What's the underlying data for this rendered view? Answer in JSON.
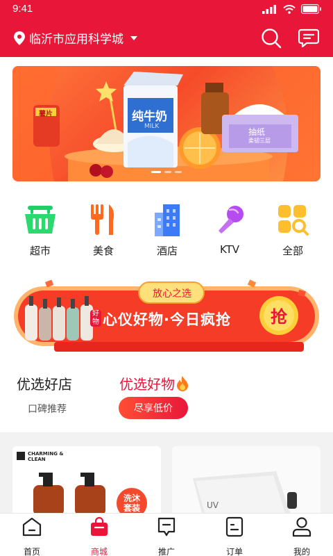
{
  "status": {
    "time": "9:41"
  },
  "header": {
    "location": "临沂市应用科学城"
  },
  "banner": {
    "milk_text": "纯牛奶",
    "milk_sub": "MILK",
    "badge_text": "薯片",
    "tissue_text": "抽纸",
    "tissue_sub": "柔韧三层"
  },
  "categories": [
    {
      "label": "超市",
      "icon": "basket-icon"
    },
    {
      "label": "美食",
      "icon": "cutlery-icon"
    },
    {
      "label": "酒店",
      "icon": "building-icon"
    },
    {
      "label": "KTV",
      "icon": "microphone-icon"
    },
    {
      "label": "全部",
      "icon": "grid-search-icon"
    }
  ],
  "promo": {
    "tag": "放心之选",
    "title": "心仪好物·今日疯抢",
    "side_label": "好物",
    "grab": "抢"
  },
  "selections": {
    "left_title": "优选好店",
    "left_sub": "口碑推荐",
    "right_title": "优选好物",
    "right_button": "尽享低价"
  },
  "products": [
    {
      "brand": "CHARMING & CLEAN",
      "tag": "洗沐套装"
    },
    {
      "mark": "UV"
    }
  ],
  "tabbar": [
    {
      "label": "首页",
      "active": false
    },
    {
      "label": "商城",
      "active": true
    },
    {
      "label": "推广",
      "active": false
    },
    {
      "label": "订单",
      "active": false
    },
    {
      "label": "我的",
      "active": false
    }
  ],
  "colors": {
    "brand": "#e8173a",
    "accent": "#ff4e34"
  }
}
